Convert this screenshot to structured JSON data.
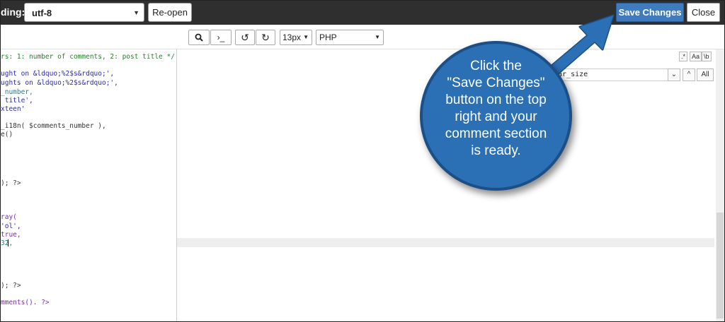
{
  "topbar": {
    "encoding_label": "ding:",
    "encoding_value": "utf-8",
    "reopen_label": "Re-open",
    "save_label": "Save Changes",
    "close_label": "Close",
    "save_color": "#3f7bbd"
  },
  "toolbar": {
    "search_icon": "search-icon",
    "terminal_glyph": "›_",
    "undo_glyph": "↺",
    "redo_glyph": "↻",
    "font_size": "13px",
    "language": "PHP"
  },
  "code_lines": [
    "rs: 1: number of comments, 2: post title */",
    "ught on &ldquo;%2$s&rdquo;',",
    "ughts on &ldquo;%2$s&rdquo;',",
    "_number,",
    " title',",
    "xteen'",
    "_i18n( $comments_number ),",
    "e()",
    "); ?>",
    "ray(",
    "'ol',",
    "true,",
    "32,",
    "); ?>",
    "mments(). ?>"
  ],
  "search": {
    "regex_btn": ".*",
    "case_btn": "Aa",
    "word_btn": "\\b",
    "field_value": "tar_size",
    "dropdown_glyph": "⌄",
    "up_glyph": "^",
    "all_label": "All"
  },
  "callout": {
    "lines": [
      "Click the",
      "\"Save Changes\"",
      "button on the top",
      "right and your",
      "comment section",
      "is ready."
    ],
    "bubble_color": "#2b6fb5",
    "arrow_color": "#2b6fb5"
  }
}
